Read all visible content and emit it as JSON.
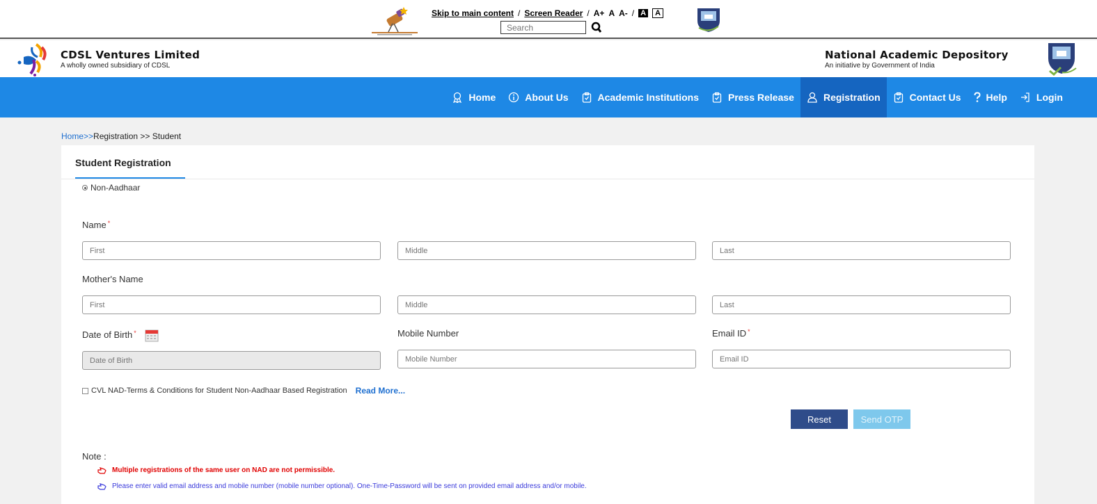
{
  "accessibility_bar": {
    "skip_link": "Skip to main content",
    "sep1": "/",
    "screen_reader": "Screen Reader",
    "sep2": "/",
    "font_increase": "A+",
    "font_normal": "A",
    "font_decrease": "A-",
    "sep3": "/",
    "contrast_dark": "A",
    "contrast_light": "A",
    "search_placeholder": "Search"
  },
  "header": {
    "left_title": "CDSL Ventures Limited",
    "left_subtitle": "A wholly owned subsidiary of CDSL",
    "right_title": "National Academic Depository",
    "right_subtitle": "An initiative by Government of India"
  },
  "nav": {
    "items": [
      {
        "label": "Home",
        "icon": "award-icon"
      },
      {
        "label": "About Us",
        "icon": "info-icon"
      },
      {
        "label": "Academic Institutions",
        "icon": "clipboard-icon"
      },
      {
        "label": "Press Release",
        "icon": "clipboard-icon"
      },
      {
        "label": "Registration",
        "icon": "user-icon",
        "active": true
      },
      {
        "label": "Contact Us",
        "icon": "clipboard-icon"
      },
      {
        "label": "Help",
        "icon": "question-icon"
      },
      {
        "label": "Login",
        "icon": "login-icon"
      }
    ]
  },
  "breadcrumb": {
    "home": "Home",
    "sep1": ">>",
    "registration": "Registration",
    "sep2": ">>",
    "current": "Student"
  },
  "form": {
    "tab_label": "Student Registration",
    "radio_label": "Non-Aadhaar",
    "name_label": "Name",
    "required_mark": "*",
    "name_first_placeholder": "First",
    "name_middle_placeholder": "Middle",
    "name_last_placeholder": "Last",
    "mother_label": "Mother's Name",
    "mother_first_placeholder": "First",
    "mother_middle_placeholder": "Middle",
    "mother_last_placeholder": "Last",
    "dob_label": "Date of Birth",
    "dob_placeholder": "Date of Birth",
    "mobile_label": "Mobile Number",
    "mobile_placeholder": "Mobile Number",
    "email_label": "Email ID",
    "email_placeholder": "Email ID",
    "terms_text": "CVL NAD-Terms & Conditions for Student Non-Aadhaar Based Registration",
    "read_more": "Read More...",
    "reset_button": "Reset",
    "send_otp_button": "Send OTP"
  },
  "notes": {
    "title": "Note :",
    "items": [
      "Multiple registrations of the same user on NAD are not permissible.",
      "Please enter valid email address and mobile number (mobile number optional). One-Time-Password will be sent on provided email address and/or mobile."
    ]
  },
  "colors": {
    "nav_bg": "#1e88e5",
    "nav_active": "#1565c0",
    "reset_btn": "#2f4c8a",
    "otp_btn": "#7ec8ec",
    "required": "#e53935",
    "link": "#1e6fd0"
  }
}
